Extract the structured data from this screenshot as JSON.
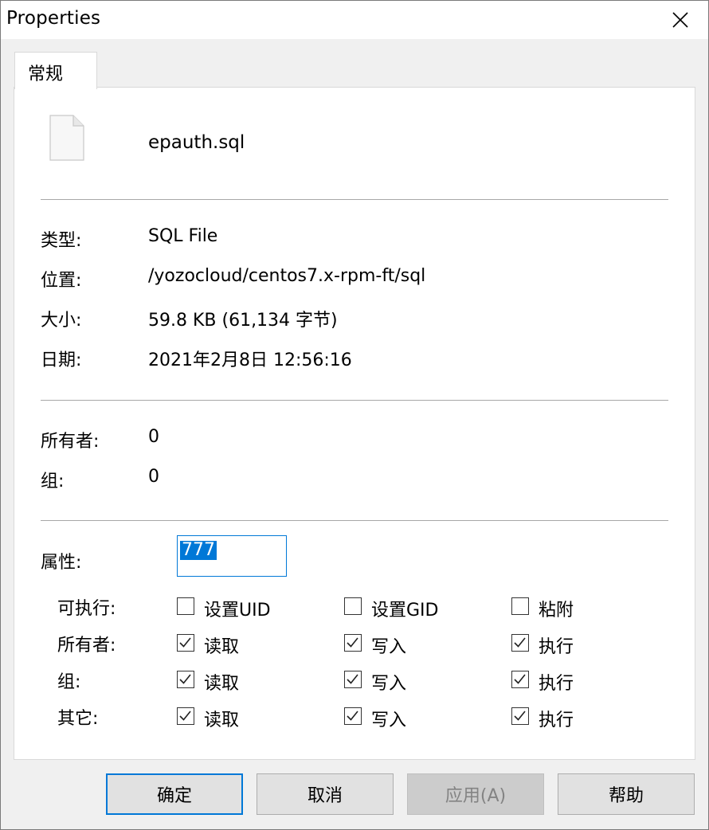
{
  "window": {
    "title": "Properties"
  },
  "tabs": [
    {
      "label": "常规"
    }
  ],
  "file": {
    "name": "epauth.sql"
  },
  "info": [
    {
      "label": "类型:",
      "value": "SQL File"
    },
    {
      "label": "位置:",
      "value": "/yozocloud/centos7.x-rpm-ft/sql"
    },
    {
      "label": "大小:",
      "value": "59.8 KB (61,134 字节)"
    },
    {
      "label": "日期:",
      "value": "2021年2月8日 12:56:16"
    }
  ],
  "ownership": [
    {
      "label": "所有者:",
      "value": "0"
    },
    {
      "label": "组:",
      "value": "0"
    }
  ],
  "attributes": {
    "label": "属性:",
    "value": "777"
  },
  "permissions": [
    {
      "label": "可执行:",
      "options": [
        {
          "label": "设置UID",
          "checked": false
        },
        {
          "label": "设置GID",
          "checked": false
        },
        {
          "label": "粘附",
          "checked": false
        }
      ]
    },
    {
      "label": "所有者:",
      "options": [
        {
          "label": "读取",
          "checked": true
        },
        {
          "label": "写入",
          "checked": true
        },
        {
          "label": "执行",
          "checked": true
        }
      ]
    },
    {
      "label": "组:",
      "options": [
        {
          "label": "读取",
          "checked": true
        },
        {
          "label": "写入",
          "checked": true
        },
        {
          "label": "执行",
          "checked": true
        }
      ]
    },
    {
      "label": "其它:",
      "options": [
        {
          "label": "读取",
          "checked": true
        },
        {
          "label": "写入",
          "checked": true
        },
        {
          "label": "执行",
          "checked": true
        }
      ]
    }
  ],
  "buttons": {
    "ok": "确定",
    "cancel": "取消",
    "apply": "应用(A)",
    "help": "帮助"
  },
  "colors": {
    "accent": "#0078d7",
    "panel": "#ffffff",
    "window_bg": "#f0f0f0"
  }
}
